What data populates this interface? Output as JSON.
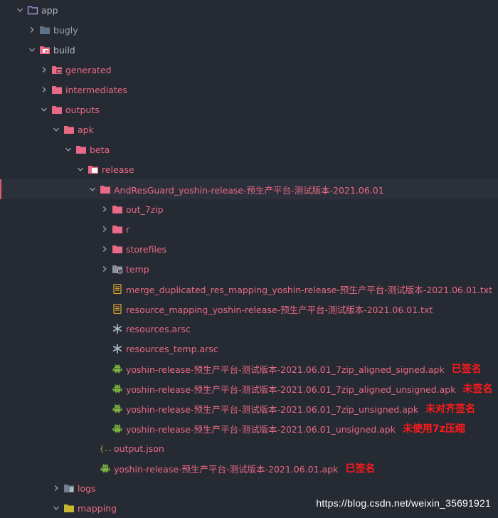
{
  "tree": [
    {
      "depth": 0,
      "name": "app",
      "kind": "folder",
      "chevron": "down",
      "icon": "folder-outline",
      "tone": "normal"
    },
    {
      "depth": 1,
      "name": "bugly",
      "kind": "folder",
      "chevron": "right",
      "icon": "folder-gray",
      "tone": "muted"
    },
    {
      "depth": 1,
      "name": "build",
      "kind": "folder",
      "chevron": "down",
      "icon": "folder-build-open",
      "tone": "normal"
    },
    {
      "depth": 2,
      "name": "generated",
      "kind": "folder",
      "chevron": "right",
      "icon": "folder-generated",
      "tone": "excluded"
    },
    {
      "depth": 2,
      "name": "intermediates",
      "kind": "folder",
      "chevron": "right",
      "icon": "folder-pink",
      "tone": "excluded"
    },
    {
      "depth": 2,
      "name": "outputs",
      "kind": "folder",
      "chevron": "down",
      "icon": "folder-pink",
      "tone": "excluded"
    },
    {
      "depth": 3,
      "name": "apk",
      "kind": "folder",
      "chevron": "down",
      "icon": "folder-pink",
      "tone": "excluded"
    },
    {
      "depth": 4,
      "name": "beta",
      "kind": "folder",
      "chevron": "down",
      "icon": "folder-pink",
      "tone": "excluded"
    },
    {
      "depth": 5,
      "name": "release",
      "kind": "folder",
      "chevron": "down",
      "icon": "folder-open-pink",
      "tone": "excluded"
    },
    {
      "depth": 6,
      "name": "AndResGuard_yoshin-release-预生产平台-测试版本-2021.06.01",
      "kind": "folder",
      "chevron": "down",
      "icon": "folder-pink",
      "tone": "excluded",
      "selected": true
    },
    {
      "depth": 7,
      "name": "out_7zip",
      "kind": "folder",
      "chevron": "right",
      "icon": "folder-pink",
      "tone": "excluded"
    },
    {
      "depth": 7,
      "name": "r",
      "kind": "folder",
      "chevron": "right",
      "icon": "folder-pink",
      "tone": "excluded"
    },
    {
      "depth": 7,
      "name": "storefiles",
      "kind": "folder",
      "chevron": "right",
      "icon": "folder-pink",
      "tone": "excluded"
    },
    {
      "depth": 7,
      "name": "temp",
      "kind": "folder",
      "chevron": "right",
      "icon": "folder-temp",
      "tone": "excluded"
    },
    {
      "depth": 7,
      "name": "merge_duplicated_res_mapping_yoshin-release-预生产平台-测试版本-2021.06.01.txt",
      "kind": "file",
      "icon": "text-file",
      "tone": "excluded"
    },
    {
      "depth": 7,
      "name": "resource_mapping_yoshin-release-预生产平台-测试版本-2021.06.01.txt",
      "kind": "file",
      "icon": "text-file",
      "tone": "excluded"
    },
    {
      "depth": 7,
      "name": "resources.arsc",
      "kind": "file",
      "icon": "asterisk",
      "tone": "excluded"
    },
    {
      "depth": 7,
      "name": "resources_temp.arsc",
      "kind": "file",
      "icon": "asterisk",
      "tone": "excluded"
    },
    {
      "depth": 7,
      "name": "yoshin-release-预生产平台-测试版本-2021.06.01_7zip_aligned_signed.apk",
      "kind": "file",
      "icon": "android",
      "tone": "excluded",
      "note": "已签名"
    },
    {
      "depth": 7,
      "name": "yoshin-release-预生产平台-测试版本-2021.06.01_7zip_aligned_unsigned.apk",
      "kind": "file",
      "icon": "android",
      "tone": "excluded",
      "note": "未签名"
    },
    {
      "depth": 7,
      "name": "yoshin-release-预生产平台-测试版本-2021.06.01_7zip_unsigned.apk",
      "kind": "file",
      "icon": "android",
      "tone": "excluded",
      "note": "未对齐签名"
    },
    {
      "depth": 7,
      "name": "yoshin-release-预生产平台-测试版本-2021.06.01_unsigned.apk",
      "kind": "file",
      "icon": "android",
      "tone": "excluded",
      "note": "未使用7z压缩"
    },
    {
      "depth": 6,
      "name": "output.json",
      "kind": "file",
      "icon": "json",
      "tone": "excluded"
    },
    {
      "depth": 6,
      "name": "yoshin-release-预生产平台-测试版本-2021.06.01.apk",
      "kind": "file",
      "icon": "android",
      "tone": "excluded",
      "note": "已签名"
    },
    {
      "depth": 3,
      "name": "logs",
      "kind": "folder",
      "chevron": "right",
      "icon": "folder-logs",
      "tone": "excluded"
    },
    {
      "depth": 3,
      "name": "mapping",
      "kind": "folder",
      "chevron": "down",
      "icon": "folder-mapping",
      "tone": "excluded"
    }
  ],
  "watermark": "https://blog.csdn.net/weixin_35691921",
  "colors": {
    "background": "#262a33",
    "excluded_text": "#e96a86",
    "normal_text": "#b4bac4",
    "folder_pink": "#e96a86",
    "android_green": "#7cb342",
    "annotation_red": "#ff1a1a"
  }
}
